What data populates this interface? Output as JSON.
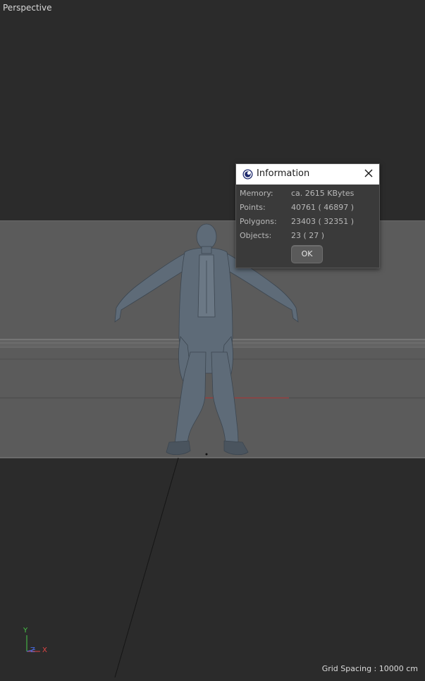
{
  "viewport": {
    "label": "Perspective",
    "grid_spacing": "Grid Spacing : 10000 cm",
    "axes": {
      "y": "Y",
      "z": "Z",
      "x": "X"
    }
  },
  "dialog": {
    "title": "Information",
    "icon": "cinema4d-logo-icon",
    "close_icon": "close-icon",
    "rows": [
      {
        "label": "Memory:",
        "value": "ca. 2615 KBytes"
      },
      {
        "label": "Points:",
        "value": "40761 ( 46897 )"
      },
      {
        "label": "Polygons:",
        "value": "23403 ( 32351 )"
      },
      {
        "label": "Objects:",
        "value": "23 ( 27 )"
      }
    ],
    "ok_label": "OK"
  },
  "colors": {
    "background": "#2b2b2b",
    "backdrop": "#5b5b5b",
    "model": "#5e6b78",
    "x_axis": "#e04646",
    "y_axis": "#48c848",
    "z_axis": "#4a6ae0"
  }
}
